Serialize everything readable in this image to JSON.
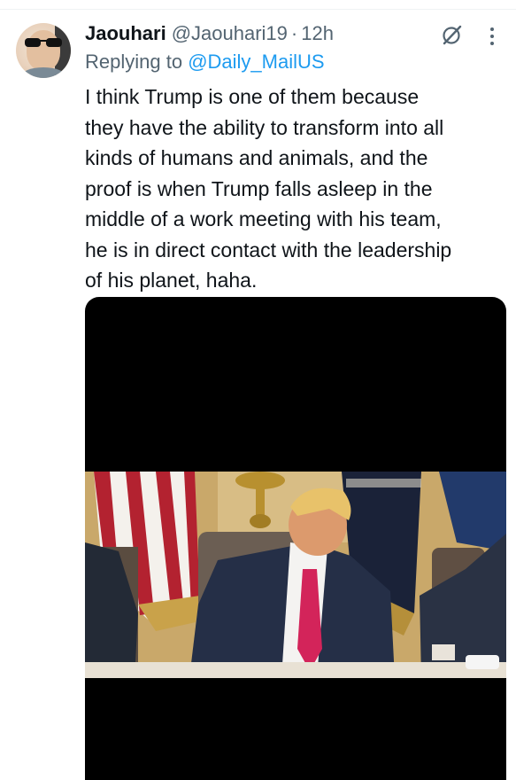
{
  "tweet": {
    "display_name": "Jaouhari",
    "handle": "@Jaouhari19",
    "separator": "·",
    "time": "12h",
    "reply_prefix": "Replying to ",
    "reply_to": "@Daily_MailUS",
    "text": "I think Trump is one of them because\nthey have the ability to transform into all\nkinds of humans and animals, and the\nproof is when Trump falls asleep in the\nmiddle of a work meeting with his team,\nhe is in direct contact with the leadership\nof his planet, haha."
  },
  "icons": {
    "avatar": "profile-photo",
    "grok": "grok-icon",
    "more": "more-icon"
  },
  "colors": {
    "text": "#0f1419",
    "secondary": "#536471",
    "link": "#1d9bf0",
    "media_bg": "#000000"
  }
}
